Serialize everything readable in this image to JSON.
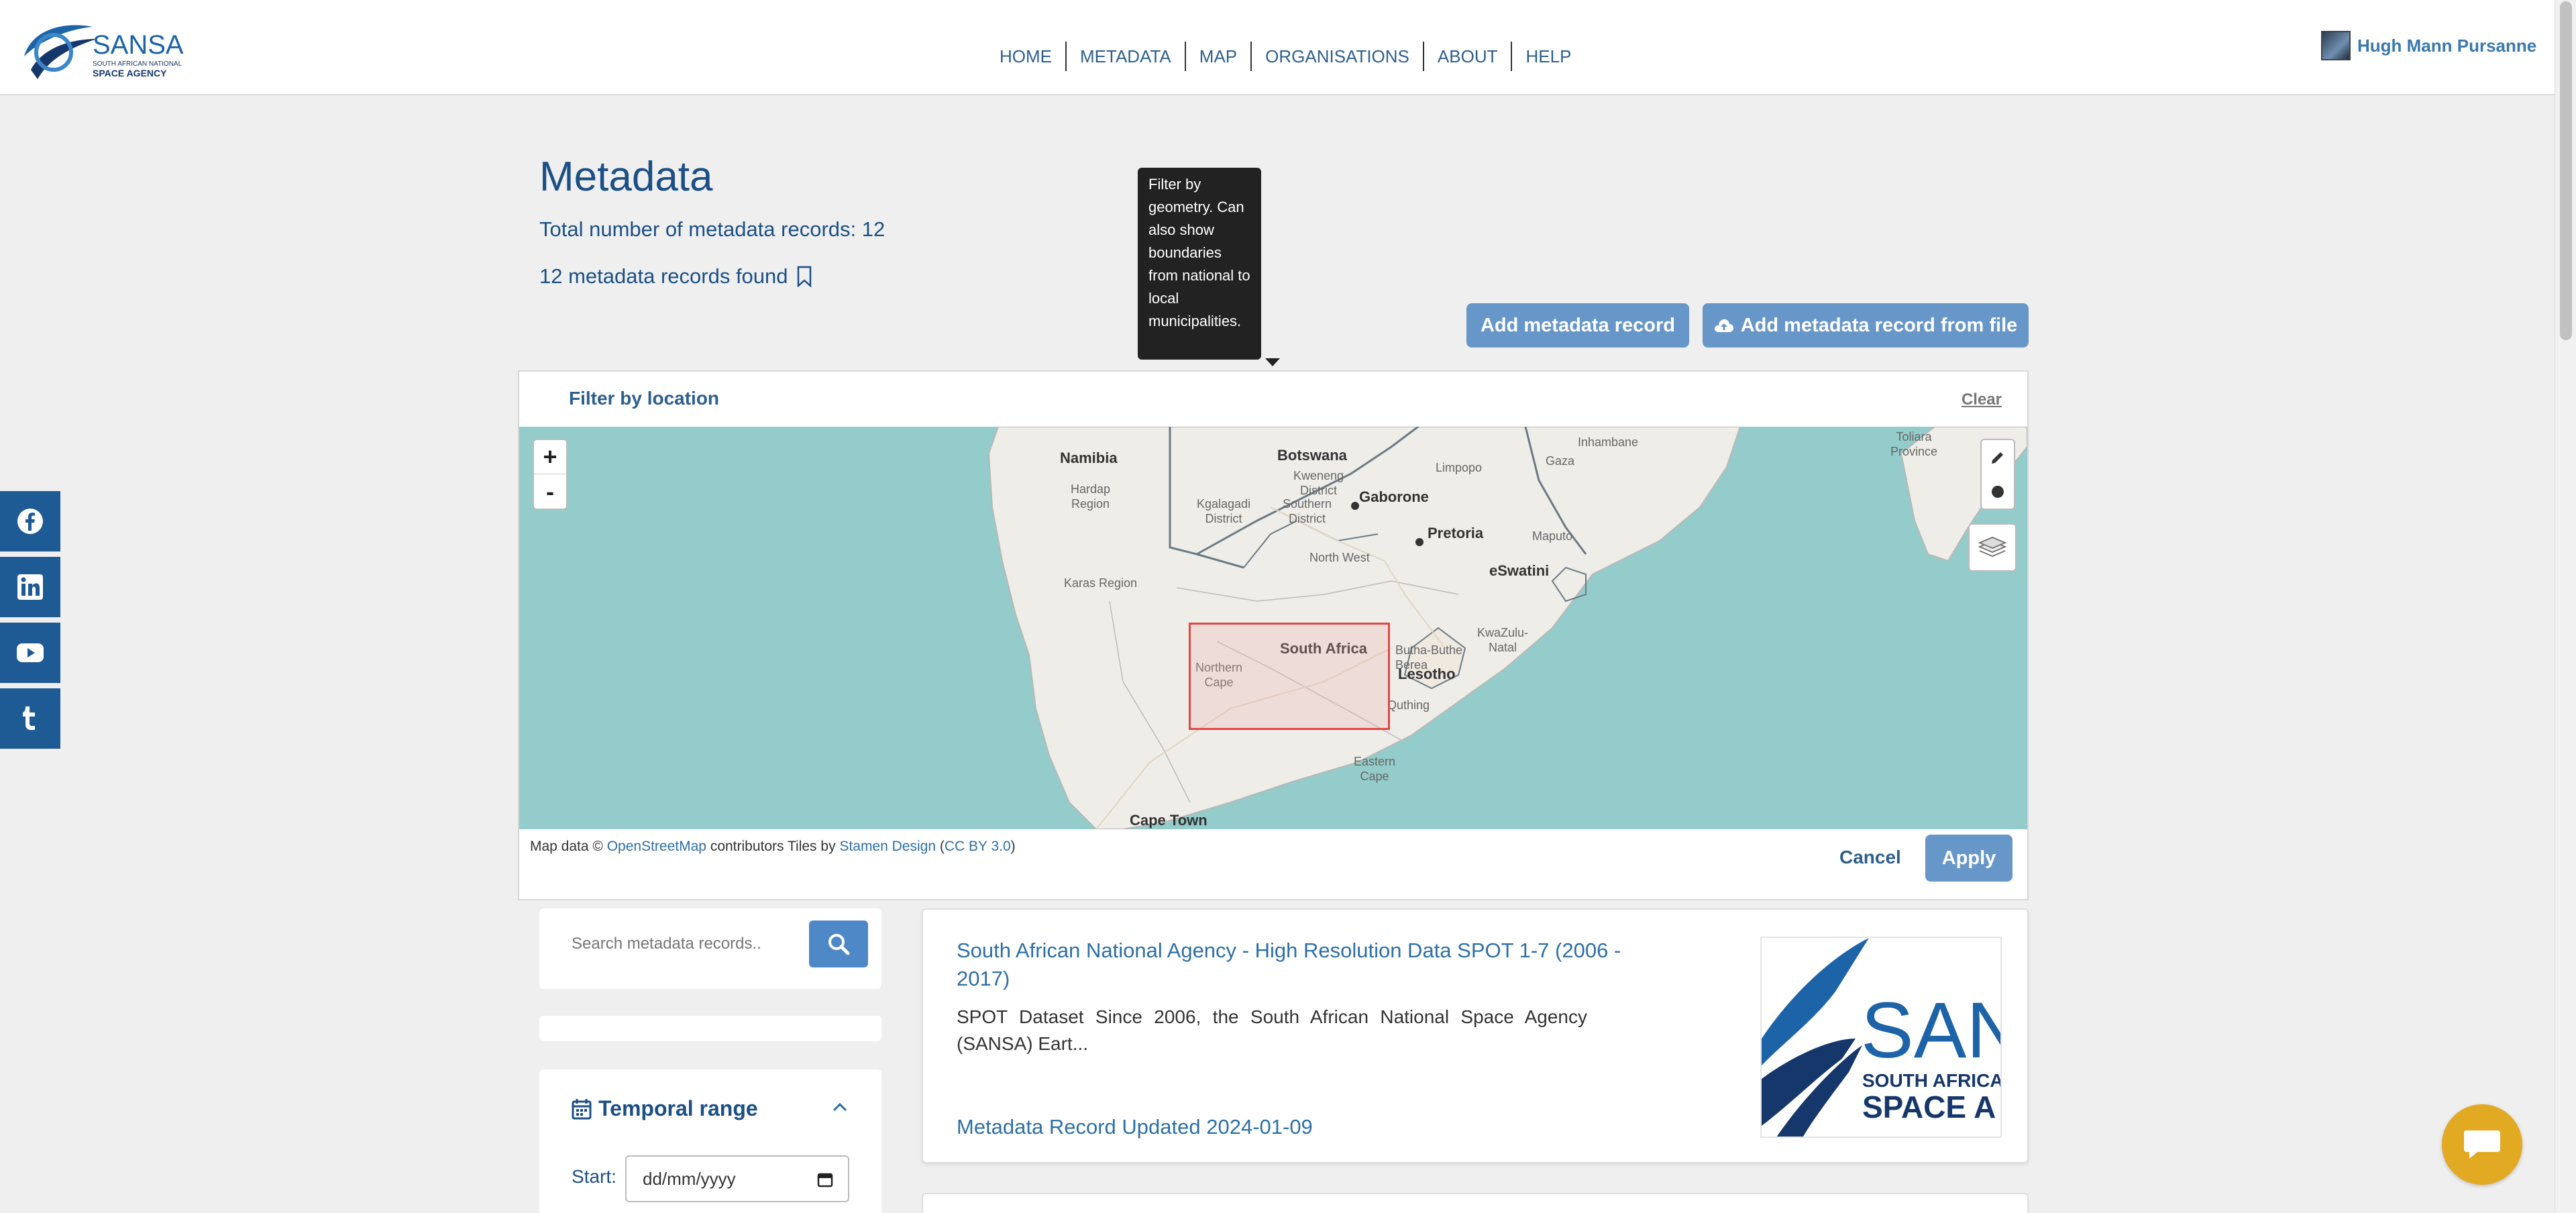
{
  "brand": {
    "name": "SANSA",
    "tagline_line1": "SOUTH AFRICAN NATIONAL",
    "tagline_line2": "SPACE AGENCY"
  },
  "nav": {
    "items": [
      {
        "label": "HOME"
      },
      {
        "label": "METADATA"
      },
      {
        "label": "MAP"
      },
      {
        "label": "ORGANISATIONS"
      },
      {
        "label": "ABOUT"
      },
      {
        "label": "HELP"
      }
    ]
  },
  "user": {
    "name": "Hugh Mann Pursanne"
  },
  "page": {
    "title": "Metadata",
    "total": "Total number of metadata records: 12",
    "found": "12 metadata records found"
  },
  "tooltip": {
    "text": "Filter by geometry. Can also show boundaries from national to local municipalities."
  },
  "actions": {
    "add": "Add metadata record",
    "add_file": "Add metadata record from file"
  },
  "filter": {
    "title": "Filter by location",
    "clear": "Clear",
    "cancel": "Cancel",
    "apply": "Apply",
    "zoom_in": "+",
    "zoom_out": "-",
    "attribution": {
      "prefix": "Map data ©",
      "osm": "OpenStreetMap",
      "mid": "contributors   Tiles by",
      "stamen": "Stamen Design",
      "license": "CC BY 3.0"
    },
    "map_labels": {
      "namibia": "Namibia",
      "botswana": "Botswana",
      "gaborone": "Gaborone",
      "pretoria": "Pretoria",
      "eswatini": "eSwatini",
      "south_africa": "South Africa",
      "lesotho": "Lesotho",
      "cape_town": "Cape Town",
      "limpopo": "Limpopo",
      "gaza": "Gaza",
      "inhambane": "Inhambane",
      "maputo": "Maputo",
      "hardap": "Hardap\nRegion",
      "karas": "Karas Region",
      "kgalagadi": "Kgalagadi\nDistrict",
      "kweneng": "Kweneng\nDistrict",
      "southern": "Southern\nDistrict",
      "north_west": "North West",
      "northern_cape": "Northern\nCape",
      "kwazulu": "KwaZulu-\nNatal",
      "butha": "Butha-Buthe",
      "berea": "Berea",
      "quthing": "Quthing",
      "eastern_cape": "Eastern\nCape",
      "toliara": "Toliara\nProvince"
    }
  },
  "social": {
    "icons": [
      "facebook-icon",
      "linkedin-icon",
      "youtube-icon",
      "tumblr-icon"
    ]
  },
  "search": {
    "placeholder": "Search metadata records.."
  },
  "temporal": {
    "title": "Temporal range",
    "start_label": "Start:",
    "start_value": "dd/mm/yyyy"
  },
  "results": [
    {
      "title": "South African National Agency - High Resolution Data SPOT 1-7 (2006 - 2017)",
      "description": "SPOT Dataset Since 2006, the South African National Space Agency (SANSA) Eart...",
      "updated": "Metadata Record Updated 2024-01-09",
      "thumb_text1": "SAN",
      "thumb_text2": "SOUTH AFRICA",
      "thumb_text3": "SPACE A"
    }
  ],
  "colors": {
    "primary": "#1b4f86",
    "button": "#6796c8",
    "social": "#1e5a94",
    "chat": "#e2a922"
  }
}
